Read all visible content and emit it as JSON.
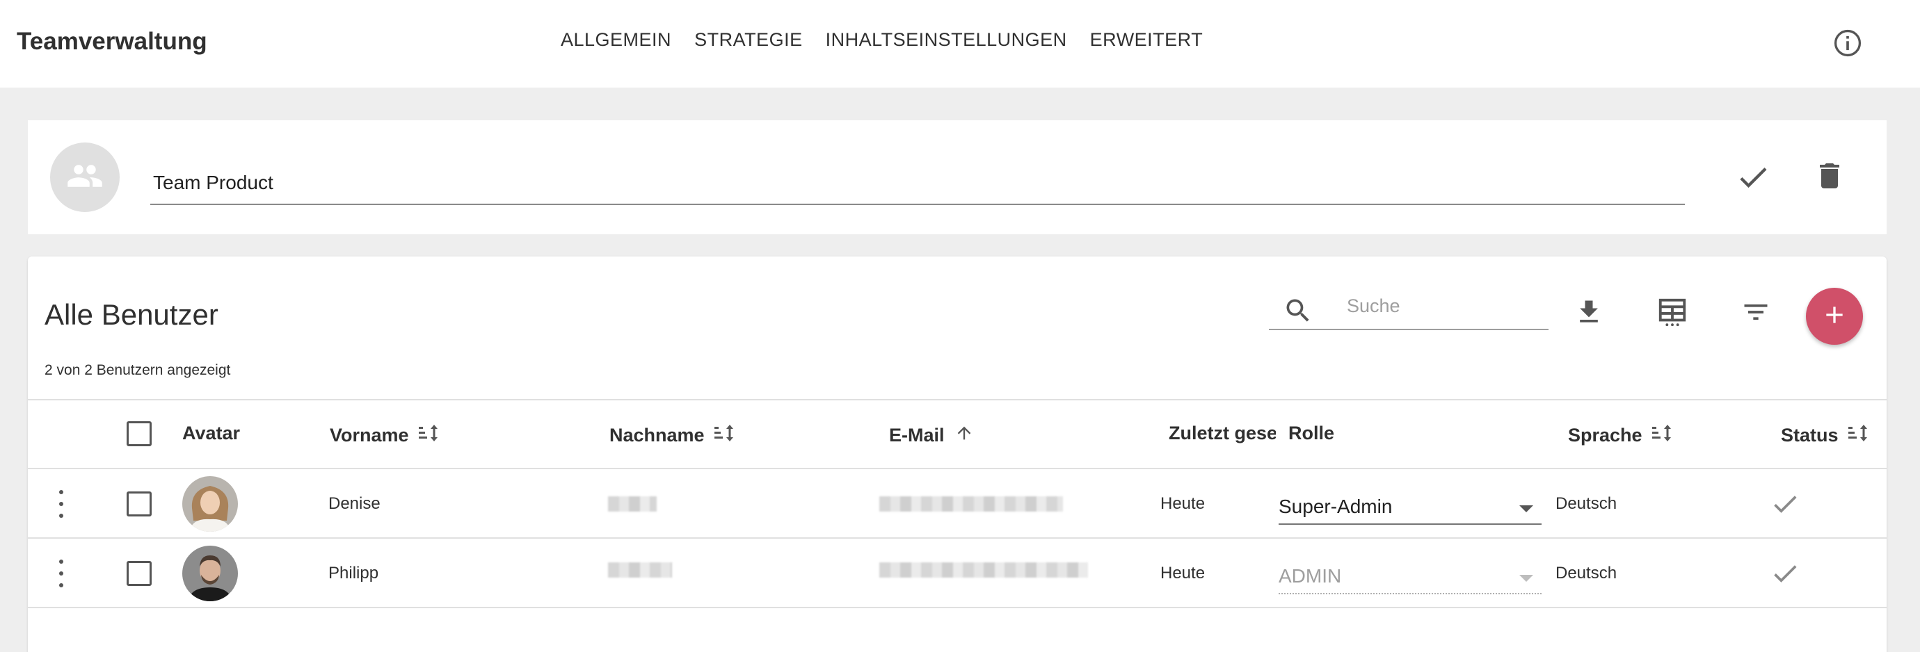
{
  "app": {
    "title": "Teamverwaltung"
  },
  "nav": {
    "items": [
      "ALLGEMEIN",
      "STRATEGIE",
      "INHALTSEINSTELLUNGEN",
      "ERWEITERT"
    ]
  },
  "icons": {
    "info": "info-icon",
    "team": "group-icon",
    "check": "check-icon",
    "delete": "trash-icon",
    "search": "search-icon",
    "download": "download-icon",
    "columns": "table-columns-icon",
    "filter": "filter-icon",
    "add": "plus-icon",
    "more": "more-vert-icon",
    "sort": "sort-icon",
    "sort_asc": "arrow-up-icon"
  },
  "colors": {
    "accent": "#d05069",
    "background": "#eeeeee",
    "card": "#ffffff"
  },
  "team": {
    "name": "Team Product"
  },
  "users": {
    "title": "Alle Benutzer",
    "count_text": "2 von 2 Benutzern angezeigt",
    "search_placeholder": "Suche",
    "columns": {
      "avatar": "Avatar",
      "firstname": "Vorname",
      "lastname": "Nachname",
      "email": "E-Mail",
      "last_seen": "Zuletzt gesehen",
      "role": "Rolle",
      "language": "Sprache",
      "status": "Status"
    },
    "rows": [
      {
        "firstname": "Denise",
        "last_seen": "Heute",
        "role": "Super-Admin",
        "role_disabled": false,
        "language": "Deutsch",
        "status": "active"
      },
      {
        "firstname": "Philipp",
        "last_seen": "Heute",
        "role": "ADMIN",
        "role_disabled": true,
        "language": "Deutsch",
        "status": "active"
      }
    ]
  }
}
